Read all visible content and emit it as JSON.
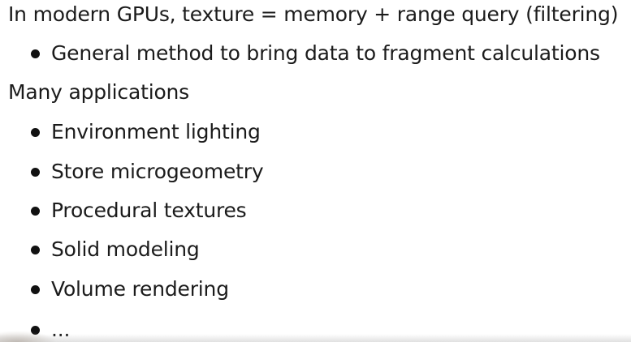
{
  "slide": {
    "items": [
      {
        "kind": "heading",
        "text": "In modern GPUs, texture = memory + range query (filtering)"
      },
      {
        "kind": "bullet",
        "text": "General method to bring data to fragment calculations"
      },
      {
        "kind": "heading",
        "text": "Many applications"
      },
      {
        "kind": "bullet",
        "text": "Environment lighting"
      },
      {
        "kind": "bullet",
        "text": "Store microgeometry"
      },
      {
        "kind": "bullet",
        "text": "Procedural textures"
      },
      {
        "kind": "bullet",
        "text": "Solid modeling"
      },
      {
        "kind": "bullet",
        "text": "Volume rendering"
      },
      {
        "kind": "bullet",
        "text": "..."
      }
    ]
  }
}
